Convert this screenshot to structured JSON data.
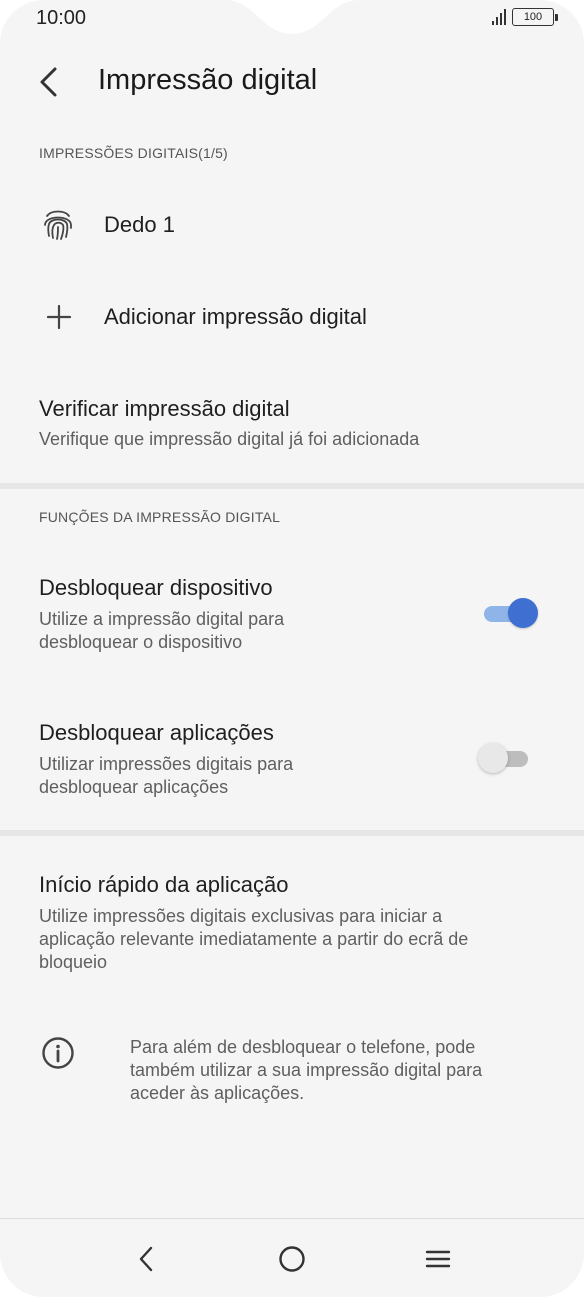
{
  "status_bar": {
    "time": "10:00",
    "battery": "100"
  },
  "header": {
    "title": "Impressão digital"
  },
  "fingerprints": {
    "section_label": "IMPRESSÕES DIGITAIS(1/5)",
    "items": [
      {
        "label": "Dedo 1"
      }
    ],
    "add_label": "Adicionar impressão digital"
  },
  "verify": {
    "title": "Verificar impressão digital",
    "subtitle": "Verifique que impressão digital já foi adicionada"
  },
  "functions": {
    "section_label": "FUNÇÕES DA IMPRESSÃO DIGITAL",
    "unlock_device": {
      "title": "Desbloquear dispositivo",
      "subtitle_1": "Utilize a impressão digital para",
      "subtitle_2": "desbloquear o dispositivo",
      "enabled": true
    },
    "unlock_apps": {
      "title": "Desbloquear aplicações",
      "subtitle_1": "Utilizar impressões digitais para",
      "subtitle_2": "desbloquear aplicações",
      "enabled": false
    }
  },
  "quick_launch": {
    "title": "Início rápido da aplicação",
    "subtitle_1": "Utilize impressões digitais exclusivas para iniciar a",
    "subtitle_2": "aplicação relevante imediatamente a partir do ecrã de",
    "subtitle_3": "bloqueio"
  },
  "info": {
    "line_1": "Para além de desbloquear o telefone, pode",
    "line_2": "também utilizar a sua impressão digital para",
    "line_3": "aceder às aplicações."
  },
  "icons": {
    "back": "back-arrow-icon",
    "fingerprint": "fingerprint-icon",
    "add": "plus-icon",
    "info": "info-icon",
    "nav_back": "nav-back-icon",
    "nav_home": "nav-home-icon",
    "nav_menu": "nav-menu-icon"
  },
  "colors": {
    "background": "#f5f5f5",
    "toggle_on_thumb": "#3f6fd0",
    "toggle_on_track": "#8fb5e8",
    "toggle_off_thumb": "#e8e8e8",
    "toggle_off_track": "#bdbdbd"
  }
}
